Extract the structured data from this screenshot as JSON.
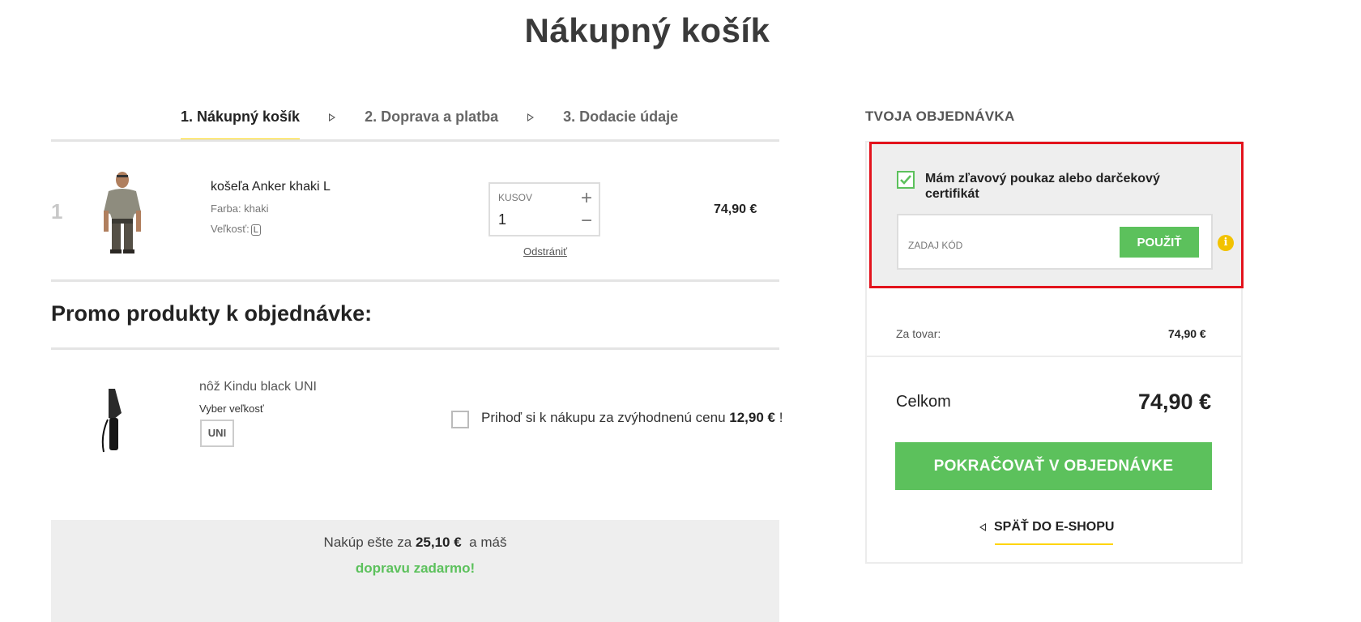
{
  "page": {
    "title": "Nákupný košík"
  },
  "steps": [
    {
      "label": "1. Nákupný košík",
      "active": true
    },
    {
      "label": "2. Doprava a platba",
      "active": false
    },
    {
      "label": "3. Dodacie údaje",
      "active": false
    }
  ],
  "cart": {
    "items": [
      {
        "index": "1",
        "name": "košeľa Anker khaki L",
        "color_label": "Farba: khaki",
        "size_label": "Veľkosť:",
        "size_value": "L",
        "quantity_label": "KUSOV",
        "quantity": "1",
        "remove_label": "Odstrániť",
        "price": "74,90 €"
      }
    ]
  },
  "promo": {
    "heading": "Promo produkty k objednávke:",
    "product_name": "nôž Kindu black UNI",
    "size_label": "Vyber veľkosť",
    "size_value": "UNI",
    "offer_text": "Prihoď si k nákupu za zvýhodnenú cenu",
    "offer_price": "12,90 €",
    "offer_suffix": "!"
  },
  "shipping": {
    "line_prefix": "Nakúp ešte za",
    "remaining": "25,10 €",
    "line_suffix": "a máš",
    "free_text": "dopravu zadarmo!"
  },
  "order": {
    "heading": "TVOJA OBJEDNÁVKA",
    "voucher_label": "Mám zľavový poukaz alebo darčekový certifikát",
    "voucher_checked": true,
    "code_placeholder": "ZADAJ KÓD",
    "apply_label": "POUŽIŤ",
    "subtotal_label": "Za tovar:",
    "subtotal_value": "74,90 €",
    "total_label": "Celkom",
    "total_value": "74,90 €",
    "continue_label": "POKRAČOVAŤ V OBJEDNÁVKE",
    "back_label": "SPÄŤ DO E-SHOPU"
  },
  "colors": {
    "accent_yellow": "#ffd400",
    "button_green": "#5cc15c",
    "highlight_red": "#e3131c",
    "info_yellow": "#f2c200"
  },
  "icons": [
    "step-arrow-icon",
    "plus-icon",
    "minus-icon",
    "check-icon",
    "info-icon",
    "back-arrow-icon"
  ]
}
